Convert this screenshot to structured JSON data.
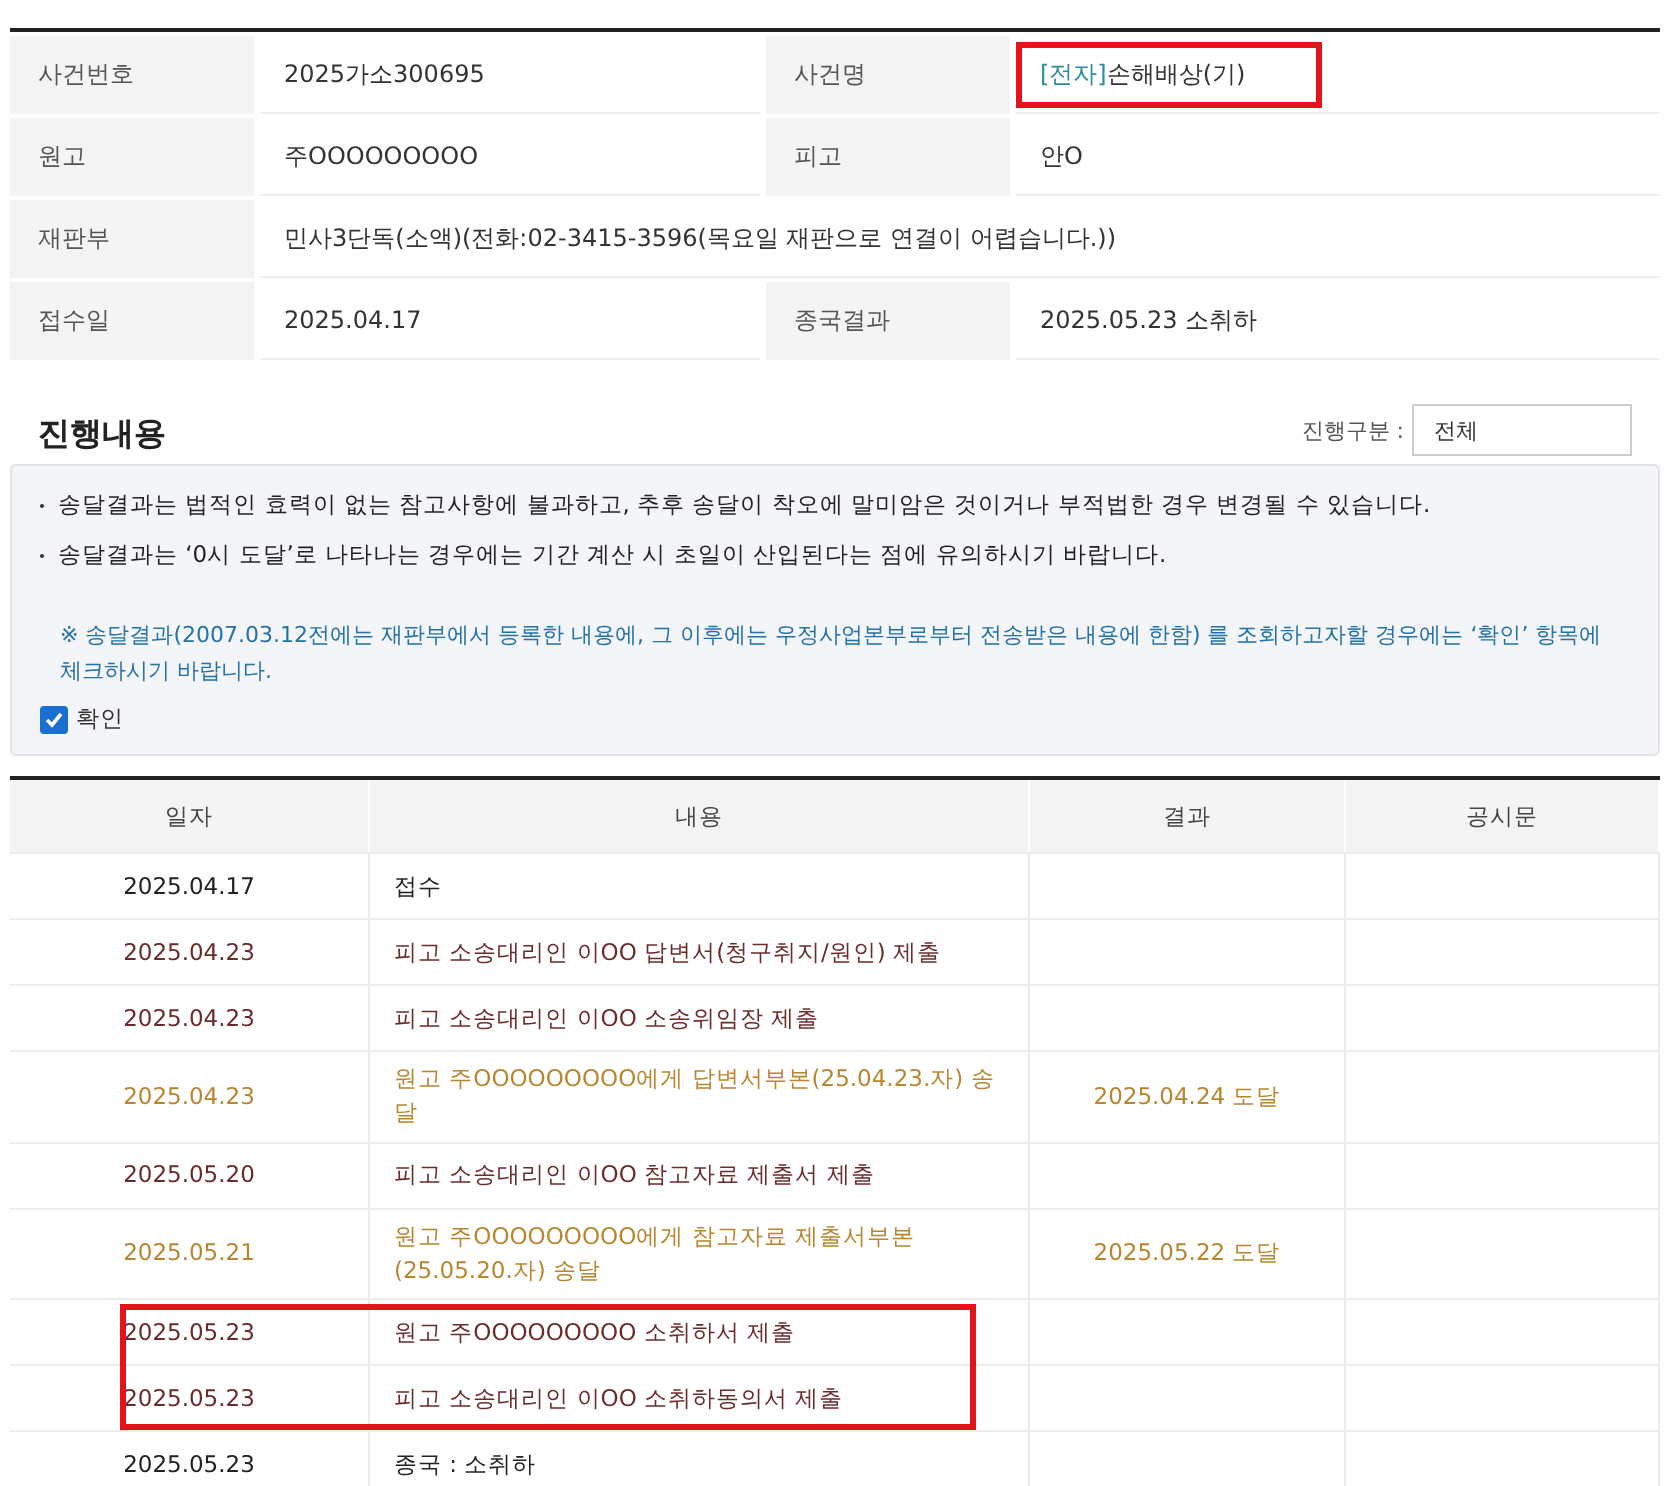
{
  "case_info": [
    {
      "label": "사건번호",
      "value": "2025가소300695"
    },
    {
      "label": "사건명",
      "prefix": "[전자]",
      "value": "손해배상(기)",
      "highlighted": true
    },
    {
      "label": "원고",
      "value": "주OOOOOOOOO"
    },
    {
      "label": "피고",
      "value": "안O"
    },
    {
      "label": "재판부",
      "value": "민사3단독(소액)(전화:02-3415-3596(목요일 재판으로 연결이 어렵습니다.))",
      "wide": true
    },
    {
      "label": "접수일",
      "value": "2025.04.17"
    },
    {
      "label": "종국결과",
      "value": "2025.05.23 소취하"
    }
  ],
  "section_title": "진행내용",
  "filter": {
    "label": "진행구분 :",
    "value": "전체"
  },
  "notice": {
    "bullets": [
      "송달결과는 법적인 효력이 없는 참고사항에 불과하고, 추후 송달이 착오에 말미암은 것이거나 부적법한 경우 변경될 수 있습니다.",
      "송달결과는 ‘0시 도달’로 나타나는 경우에는 기간 계산 시 초일이 산입된다는 점에 유의하시기 바랍니다."
    ],
    "note": "※ 송달결과(2007.03.12전에는 재판부에서 등록한 내용에, 그 이후에는 우정사업본부로부터 전송받은 내용에 한함) 를 조회하고자할 경우에는 ‘확인’ 항목에 체크하시기 바랍니다.",
    "checkbox": {
      "label": "확인",
      "checked": true
    }
  },
  "table": {
    "columns": [
      "일자",
      "내용",
      "결과",
      "공시문"
    ],
    "rows": [
      {
        "kind": "plain",
        "date": "2025.04.17",
        "content": "접수",
        "highlighted": false
      },
      {
        "kind": "filing",
        "date": "2025.04.23",
        "content": "피고 소송대리인 이OO 답변서(청구취지/원인) 제출",
        "highlighted": false
      },
      {
        "kind": "filing",
        "date": "2025.04.23",
        "content": "피고 소송대리인 이OO 소송위임장 제출",
        "highlighted": false
      },
      {
        "kind": "service",
        "date": "2025.04.23",
        "content": "원고 주OOOOOOOOO에게 답변서부본(25.04.23.자) 송달",
        "result": "2025.04.24 도달",
        "highlighted": false
      },
      {
        "kind": "filing",
        "date": "2025.05.20",
        "content": "피고 소송대리인 이OO 참고자료 제출서 제출",
        "highlighted": false
      },
      {
        "kind": "service",
        "date": "2025.05.21",
        "content": "원고 주OOOOOOOOO에게 참고자료 제출서부본(25.05.20.자) 송달",
        "result": "2025.05.22 도달",
        "highlighted": false
      },
      {
        "kind": "filing",
        "date": "2025.05.23",
        "content": "원고 주OOOOOOOOO 소취하서 제출",
        "highlighted": true
      },
      {
        "kind": "filing",
        "date": "2025.05.23",
        "content": "피고 소송대리인 이OO 소취하동의서 제출",
        "highlighted": true
      },
      {
        "kind": "plain",
        "date": "2025.05.23",
        "content": "종국 : 소취하",
        "highlighted": false
      }
    ]
  }
}
